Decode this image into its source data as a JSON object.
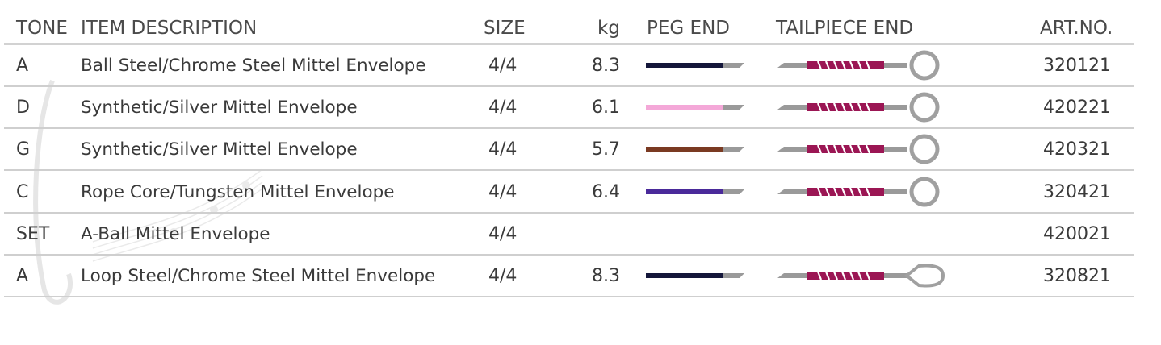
{
  "headers": {
    "tone": "TONE",
    "description": "ITEM DESCRIPTION",
    "size": "SIZE",
    "kg": "kg",
    "peg": "PEG END",
    "tail": "TAILPIECE END",
    "art": "ART.NO."
  },
  "rows": [
    {
      "tone": "A",
      "description": "Ball Steel/Chrome Steel Mittel Envelope",
      "size": "4/4",
      "kg": "8.3",
      "art": "320121",
      "peg_color": "#14163a",
      "tail_end": "ball"
    },
    {
      "tone": "D",
      "description": "Synthetic/Silver Mittel Envelope",
      "size": "4/4",
      "kg": "6.1",
      "art": "420221",
      "peg_color": "#f4a8d8",
      "tail_end": "ball"
    },
    {
      "tone": "G",
      "description": "Synthetic/Silver Mittel Envelope",
      "size": "4/4",
      "kg": "5.7",
      "art": "420321",
      "peg_color": "#7a3a22",
      "tail_end": "ball"
    },
    {
      "tone": "C",
      "description": "Rope Core/Tungsten Mittel Envelope",
      "size": "4/4",
      "kg": "6.4",
      "art": "320421",
      "peg_color": "#4a2a9a",
      "tail_end": "ball"
    },
    {
      "tone": "SET",
      "description": "A-Ball Mittel Envelope",
      "size": "4/4",
      "kg": "",
      "art": "420021",
      "peg_color": "",
      "tail_end": ""
    },
    {
      "tone": "A",
      "description": "Loop Steel/Chrome Steel Mittel Envelope",
      "size": "4/4",
      "kg": "8.3",
      "art": "320821",
      "peg_color": "#14163a",
      "tail_end": "loop"
    }
  ],
  "colors": {
    "text": "#3a3a3a",
    "rule": "#cfcfcf",
    "tail_silk": "#9b1654",
    "metal": "#9a9a9a"
  }
}
